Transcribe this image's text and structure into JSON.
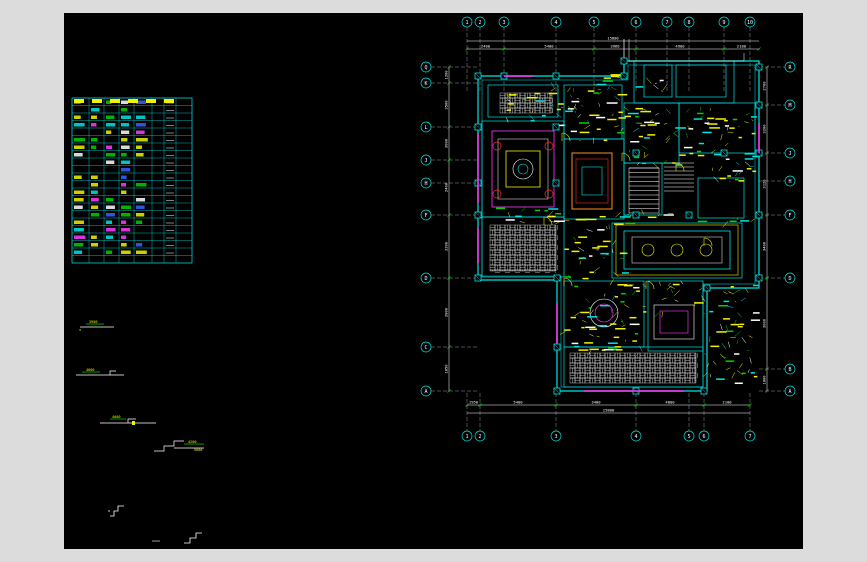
{
  "grid_top": [
    "1",
    "2",
    "3",
    "4",
    "5",
    "6",
    "7",
    "8",
    "9",
    "10"
  ],
  "grid_bottom": [
    "1",
    "2",
    "3",
    "4",
    "5",
    "6",
    "7"
  ],
  "grid_left": [
    "Q",
    "K",
    "L",
    "J",
    "H",
    "F",
    "D",
    "C",
    "A"
  ],
  "grid_right": [
    "R",
    "M",
    "J",
    "H",
    "F",
    "D",
    "B",
    "A"
  ],
  "dims_top": [
    "2400",
    "5400",
    "3960",
    "4900",
    "2100"
  ],
  "dims_top_total": "15800",
  "dims_bottom": [
    "1950",
    "5400",
    "3400",
    "4800",
    "2100"
  ],
  "dims_bottom_total": "15800",
  "dims_left": [
    "1200",
    "3500",
    "3000",
    "2400",
    "3200",
    "2800",
    "1850"
  ],
  "dims_right": [
    "2700",
    "3200",
    "3120",
    "3400",
    "3000",
    "1800"
  ],
  "stair_labels": [
    "3900",
    "4000",
    "4000",
    "4200",
    "5000"
  ],
  "colors": {
    "cyan": "#00e5e5",
    "yellow": "#f2f200",
    "green": "#00d200",
    "magenta": "#ff3cff",
    "red": "#ff2a2a",
    "white": "#ffffff",
    "blue": "#4060ff",
    "orange": "#ff8c1a"
  }
}
